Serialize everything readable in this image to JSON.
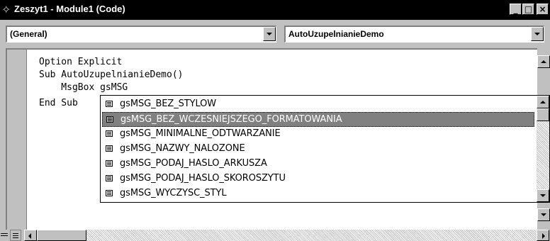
{
  "window": {
    "title": "Zeszyt1 - Module1 (Code)",
    "controls": {
      "minimize": "_",
      "maximize": "□",
      "close": "×"
    }
  },
  "object_combo": {
    "value": "(General)"
  },
  "procedure_combo": {
    "value": "AutoUzupelnianieDemo"
  },
  "code": {
    "lines": [
      "Option Explicit",
      "Sub AutoUzupelnianieDemo()",
      "    MsgBox gsMSG",
      "End Sub"
    ]
  },
  "autocomplete": {
    "selected_index": 1,
    "items": [
      "gsMSG_BEZ_STYLOW",
      "gsMSG_BEZ_WCZESNIEJSZEGO_FORMATOWANIA",
      "gsMSG_MINIMALNE_ODTWARZANIE",
      "gsMSG_NAZWY_NALOZONE",
      "gsMSG_PODAJ_HASLO_ARKUSZA",
      "gsMSG_PODAJ_HASLO_SKOROSZYTU",
      "gsMSG_WYCZYSC_STYL"
    ]
  },
  "icons": {
    "window": "vba-module-icon",
    "list_item": "constant-icon",
    "view_toggle": "procedure-view-icon"
  },
  "colors": {
    "titlebar": "#000000",
    "chrome": "#c0c0c0",
    "selection": "#808080"
  }
}
